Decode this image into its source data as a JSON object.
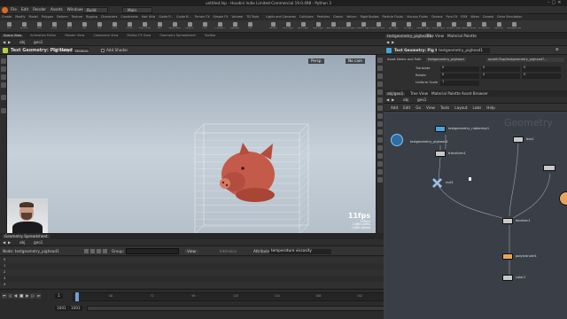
{
  "window": {
    "title": "untitled.hip - Houdini Indie Limited-Commercial 19.0.498 - Python 3"
  },
  "menubar": {
    "items": [
      "File",
      "Edit",
      "Render",
      "Assets",
      "Windows",
      "Help"
    ],
    "build": "Build",
    "desktop": "Main"
  },
  "shelf": {
    "tab_groups_left": [
      "Create",
      "Modify",
      "Model",
      "Polygon",
      "Deform",
      "Texture",
      "Rigging",
      "Characters",
      "Constraints",
      "Hair Utils",
      "Guide P...",
      "Guide B...",
      "Terrain FX",
      "Simple FX",
      "Volume",
      "TD Tools"
    ],
    "tab_groups_right": [
      "Lights and Cameras",
      "Collisions",
      "Particles",
      "Grains",
      "Vellum",
      "Rigid Bodies",
      "Particle Fluids",
      "Viscous Fluids",
      "Oceans",
      "Pyro FX",
      "FEM",
      "Wires",
      "Crowds",
      "Drive Simulation"
    ],
    "tools_left": [
      "Box",
      "Sphere",
      "Tube",
      "Torus",
      "Grid",
      "Null",
      "Line",
      "Circle",
      "Curve",
      "Draw Curve",
      "Path",
      "Spray Paint",
      "Platonic",
      "Font",
      "L-System",
      "Metaball",
      "File"
    ],
    "tools_right": [
      "Camera",
      "Point Light",
      "Spot Light",
      "Area Light",
      "Geometry Light",
      "Volume Light",
      "Distant Light",
      "Environment Light",
      "Sky Light",
      "GI Light",
      "Caustic Light",
      "Portal Light",
      "Ambient Light",
      "Stereo Camera",
      "VR Camera",
      "Switcher",
      "Gamepad Camera"
    ]
  },
  "viewer_tabs": [
    "Scene View",
    "Animation Editor",
    "Render View",
    "Composite View",
    "Motion FX View",
    "Geometry Spreadsheet",
    "Toolbar"
  ],
  "viewer": {
    "path": "obj",
    "node": "geo1",
    "tool_title": "Test Geometry: Pig Head",
    "difficulty_label": "Difficulty",
    "difficulty_value": "Medium",
    "add_shader": "Add Shader",
    "persp": "Persp",
    "cam": "No cam",
    "stats_fps": "11fps",
    "stats_ms": "105ms",
    "stats_prims": "2,880 prims",
    "stats_points": "2,880 points",
    "stats_verts": "8,640 verts"
  },
  "bottom_pane": {
    "tab": "Geometry Spreadsheet",
    "path": "obj",
    "node": "geo1",
    "node_label": "Node: testgeometry_pighead1",
    "group_label": "Group:",
    "view_label": "View",
    "intrinsics": "Intrinsics",
    "attributes_label": "Attributes:",
    "attributes_value": "temperature viscosity",
    "rows": [
      "0",
      "1",
      "2",
      "3",
      "4"
    ]
  },
  "timeline": {
    "frame": "1",
    "start": "1001",
    "start2": "1001",
    "end": "1240",
    "end2": "1240",
    "keys_label": "0 keys, 0/0 channels",
    "key_all": "Key All Channels",
    "auto_update": "Auto Update",
    "ticks": [
      "48",
      "72",
      "96",
      "120",
      "144",
      "168",
      "192",
      "216",
      "240"
    ]
  },
  "params": {
    "tabs": [
      "testgeometry_pighead1",
      "Tree View",
      "Material Palette",
      "Asset Browser"
    ],
    "title": "Test Geometry: Pig Head",
    "node_name": "testgeometry_pighead1",
    "rows": [
      {
        "label": "Translate",
        "values": [
          "0",
          "0",
          "0"
        ]
      },
      {
        "label": "Rotate",
        "values": [
          "0",
          "0",
          "0"
        ]
      },
      {
        "label": "Uniform Scale",
        "values": [
          "1"
        ]
      }
    ],
    "asset_label": "Asset Name and Path",
    "asset_value": "testgeometry_pighead",
    "asset_path": "opdef:/Sop/testgeometry_pighead?..."
  },
  "network": {
    "tabs": [
      "obj/geo1",
      "Tree View",
      "Material Palette",
      "Asset Browser"
    ],
    "path": "obj",
    "node": "geo1",
    "menu": [
      "Add",
      "Edit",
      "Go",
      "View",
      "Tools",
      "Layout",
      "Labs",
      "Help"
    ],
    "watermark": "Geometry",
    "nodes": [
      {
        "name": "testgeometry_rubbertoy1",
        "color": "#4aa3df"
      },
      {
        "name": "testgeometry_pighead1",
        "color": "#4aa3df"
      },
      {
        "name": "transform1",
        "color": "#c8c8c8"
      },
      {
        "name": "box1",
        "color": "#c8c8c8"
      },
      {
        "name": "null1",
        "color": "#9cc0e8"
      },
      {
        "name": "boolean1",
        "color": "#c8c8c8"
      },
      {
        "name": "polyextrude1",
        "color": "#e8a35a"
      },
      {
        "name": "color1",
        "color": "#c8c8c8"
      }
    ]
  },
  "colors": {
    "accent": "#e8a35a",
    "selected": "#4aa3df",
    "bg": "#2b2b2b"
  }
}
